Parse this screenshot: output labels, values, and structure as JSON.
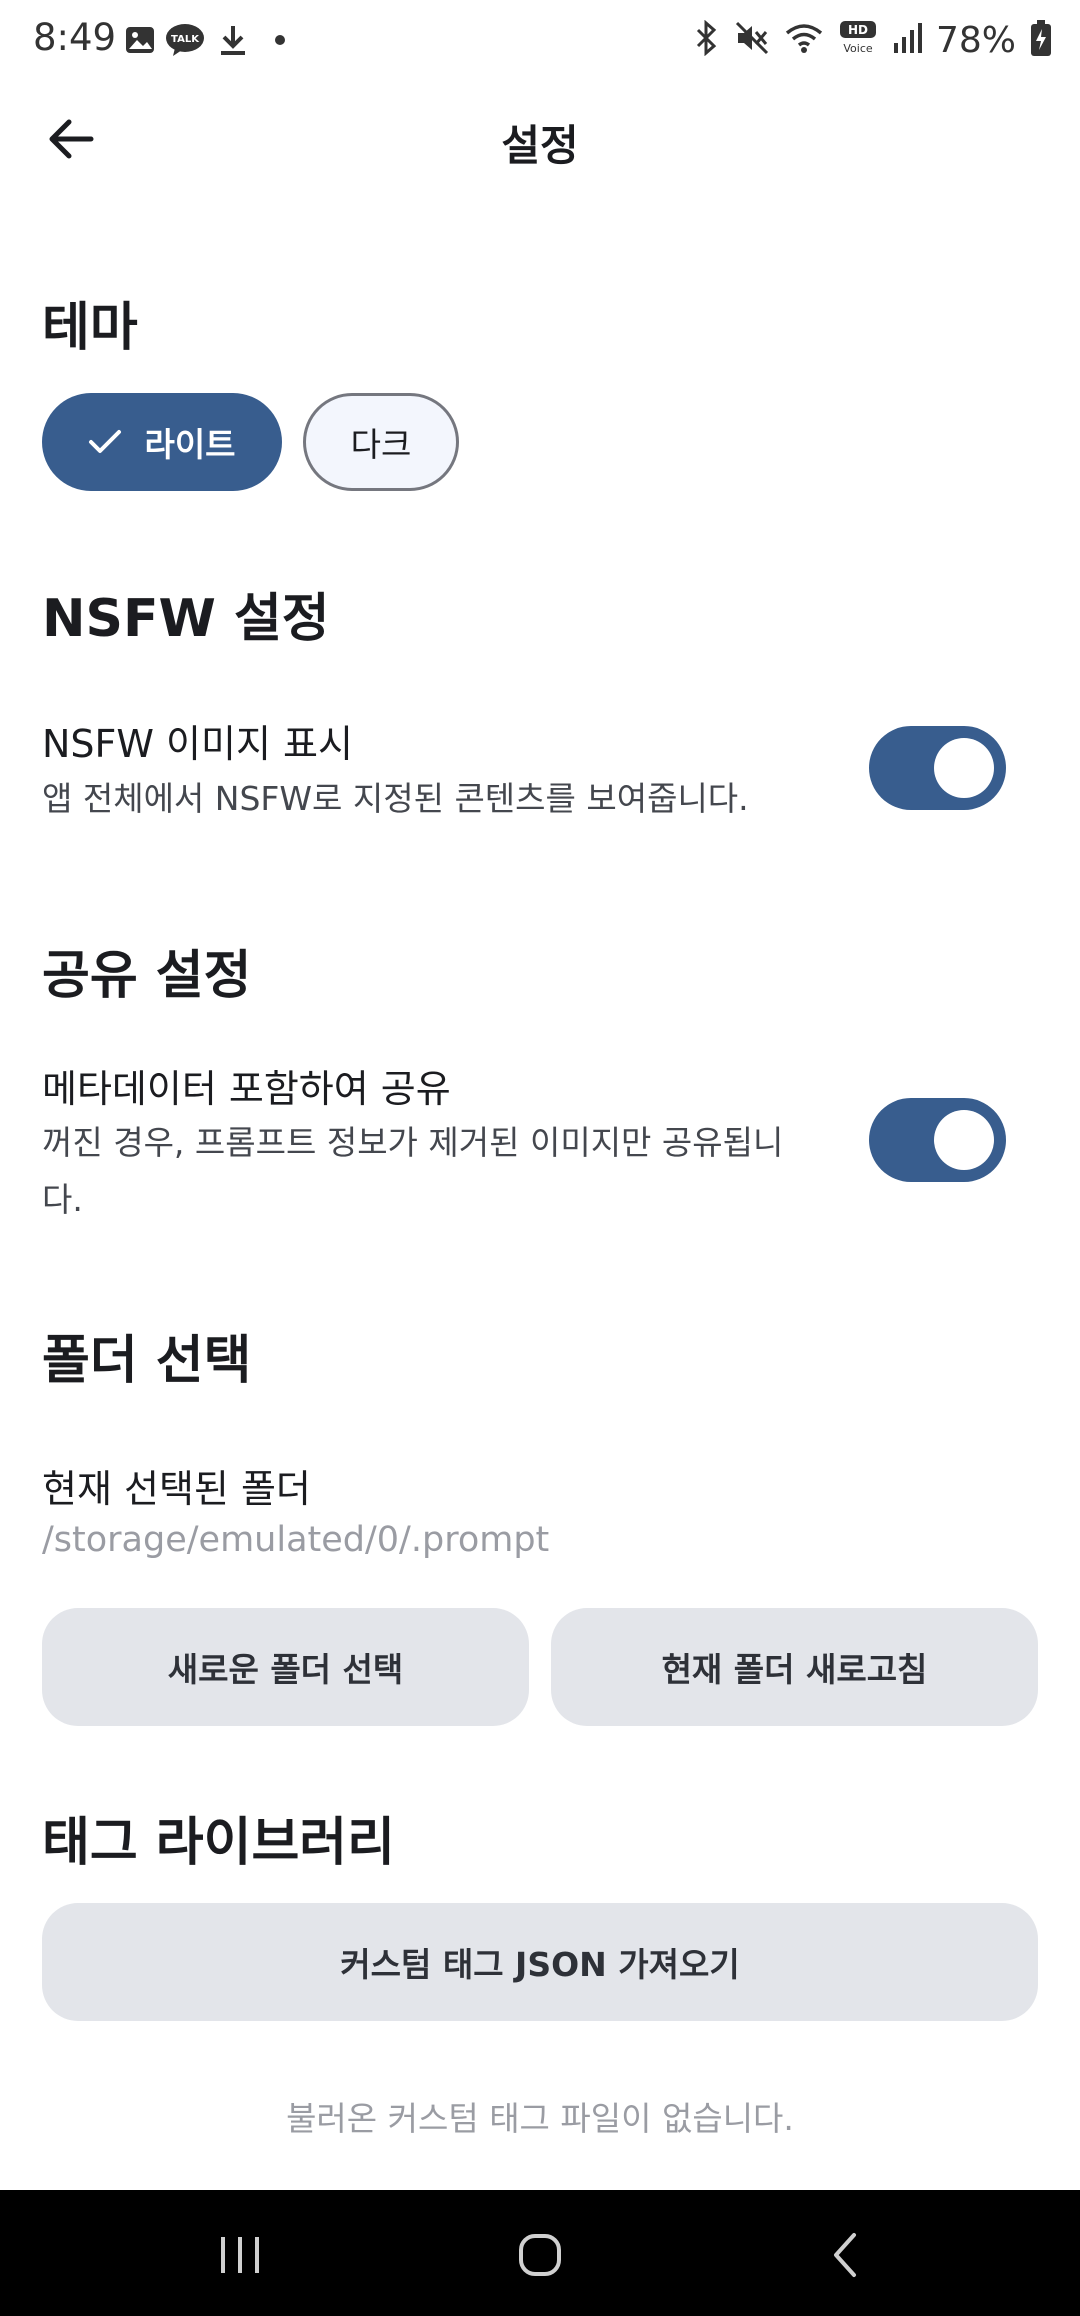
{
  "status_bar": {
    "time": "8:49",
    "left_icons": [
      "gallery-icon",
      "talk-icon",
      "download-icon",
      "dot-icon"
    ],
    "talk_label": "TALK",
    "right_icons": [
      "bluetooth-icon",
      "mute-icon",
      "wifi-icon",
      "hd-voice-icon",
      "signal-icon",
      "battery-icon"
    ],
    "hd_label": "HD",
    "voice_label": "Voice",
    "battery_percent": "78%"
  },
  "app_bar": {
    "title": "설정"
  },
  "theme": {
    "heading": "테마",
    "options": [
      {
        "label": "라이트",
        "selected": true
      },
      {
        "label": "다크",
        "selected": false
      }
    ]
  },
  "nsfw": {
    "heading": "NSFW 설정",
    "title": "NSFW 이미지 표시",
    "description": "앱 전체에서 NSFW로 지정된 콘텐츠를 보여줍니다.",
    "enabled": true
  },
  "share": {
    "heading": "공유 설정",
    "title": "메타데이터 포함하여 공유",
    "description": "꺼진 경우, 프롬프트 정보가 제거된 이미지만 공유됩니다.",
    "enabled": true
  },
  "folder": {
    "heading": "폴더 선택",
    "current_label": "현재 선택된 폴더",
    "current_path": "/storage/emulated/0/.prompt",
    "select_button": "새로운 폴더 선택",
    "refresh_button": "현재 폴더 새로고침"
  },
  "tag_library": {
    "heading": "태그 라이브러리",
    "import_button": "커스텀 태그 JSON 가져오기",
    "empty_message": "불러온 커스텀 태그 파일이 없습니다."
  },
  "colors": {
    "primary": "#385d8e",
    "background": "#ffffff",
    "button_bg": "#e3e5ea",
    "muted_text": "#9a9ca3"
  }
}
